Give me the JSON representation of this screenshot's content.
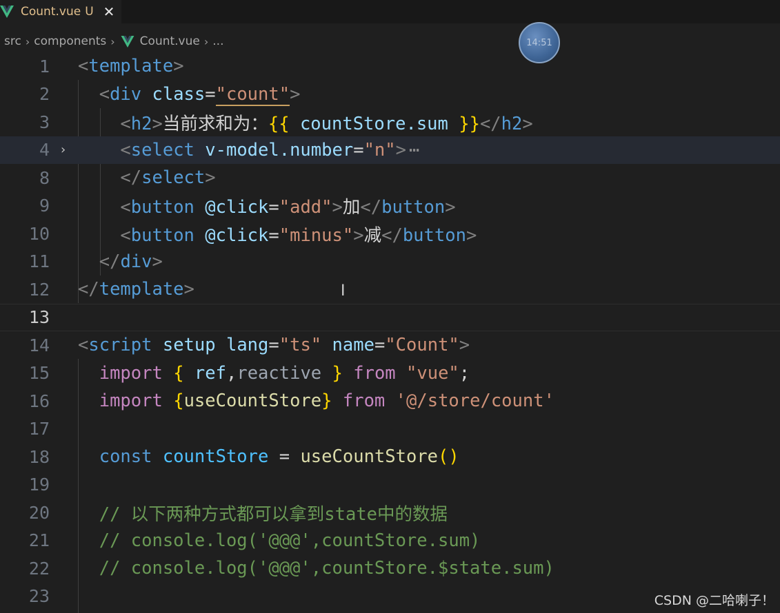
{
  "tab": {
    "name": "Count.vue",
    "status": "U",
    "close": "✕"
  },
  "breadcrumb": {
    "parts": [
      "src",
      "components",
      "Count.vue",
      "..."
    ]
  },
  "timer": {
    "time": "14:51"
  },
  "editor": {
    "lines": [
      {
        "num": "1"
      },
      {
        "num": "2"
      },
      {
        "num": "3"
      },
      {
        "num": "4"
      },
      {
        "num": "8"
      },
      {
        "num": "9"
      },
      {
        "num": "10"
      },
      {
        "num": "11"
      },
      {
        "num": "12"
      },
      {
        "num": "13"
      },
      {
        "num": "14"
      },
      {
        "num": "15"
      },
      {
        "num": "16"
      },
      {
        "num": "17"
      },
      {
        "num": "18"
      },
      {
        "num": "19"
      },
      {
        "num": "20"
      },
      {
        "num": "21"
      },
      {
        "num": "22"
      },
      {
        "num": "23"
      }
    ],
    "text": {
      "template_tag": "template",
      "div_tag": "div",
      "class_attr": "class",
      "count_val": "\"count\"",
      "h2_tag": "h2",
      "h2_text": "当前求和为：",
      "mustache_open": "{{",
      "mustache_expr": " countStore.sum ",
      "mustache_close": "}}",
      "select_tag": "select",
      "vmodel_attr": "v-model.number",
      "vmodel_val": "\"n\"",
      "fold_ellipsis": "⋯",
      "button_tag": "button",
      "click_attr": "@click",
      "add_val": "\"add\"",
      "add_text": "加",
      "minus_val": "\"minus\"",
      "minus_text": "减",
      "script_tag": "script",
      "setup_attr": "setup",
      "lang_attr": "lang",
      "ts_val": "\"ts\"",
      "name_attr": "name",
      "name_val": "\"Count\"",
      "import_kw": "import",
      "ref_name": " ref",
      "reactive_name": "reactive ",
      "from_kw": "from",
      "vue_str": "\"vue\"",
      "usecountstore": "useCountStore",
      "store_path": "'@/store/count'",
      "const_kw": "const",
      "countstore_var": "countStore",
      "comment1": "// 以下两种方式都可以拿到state中的数据",
      "comment2": "// console.log('@@@',countStore.sum)",
      "comment3": "// console.log('@@@',countStore.$state.sum)"
    }
  },
  "watermark": "CSDN @二哈喇子！",
  "colors": {
    "background": "#1f1f1f",
    "tag": "#569cd6",
    "attribute": "#9cdcfe",
    "string": "#ce9178",
    "keyword": "#c586c0",
    "comment": "#6a9955",
    "function": "#dcdcaa",
    "bracket": "#ffd700"
  }
}
